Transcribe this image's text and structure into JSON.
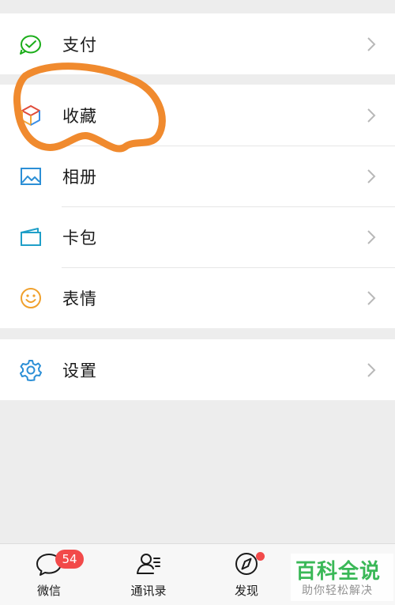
{
  "menu": {
    "group1": [
      {
        "label": "支付",
        "icon": "wallet-payment-icon"
      }
    ],
    "group2": [
      {
        "label": "收藏",
        "icon": "cube-favorites-icon"
      },
      {
        "label": "相册",
        "icon": "photo-album-icon"
      },
      {
        "label": "卡包",
        "icon": "card-wallet-icon"
      },
      {
        "label": "表情",
        "icon": "smiley-icon"
      }
    ],
    "group3": [
      {
        "label": "设置",
        "icon": "gear-icon"
      }
    ]
  },
  "tabbar": {
    "tabs": [
      {
        "label": "微信",
        "icon": "chat-bubble-icon"
      },
      {
        "label": "通讯录",
        "icon": "contacts-icon"
      },
      {
        "label": "发现",
        "icon": "compass-icon"
      }
    ],
    "chat_badge": "54"
  },
  "watermark": {
    "title": "百科全说",
    "subtitle": "助你轻松解决"
  },
  "colors": {
    "green": "#1aad19",
    "blue": "#2c8fd6",
    "orange_annotation": "#f08a2e",
    "badge_red": "#f24a4a",
    "watermark_green": "#2bb34a"
  }
}
